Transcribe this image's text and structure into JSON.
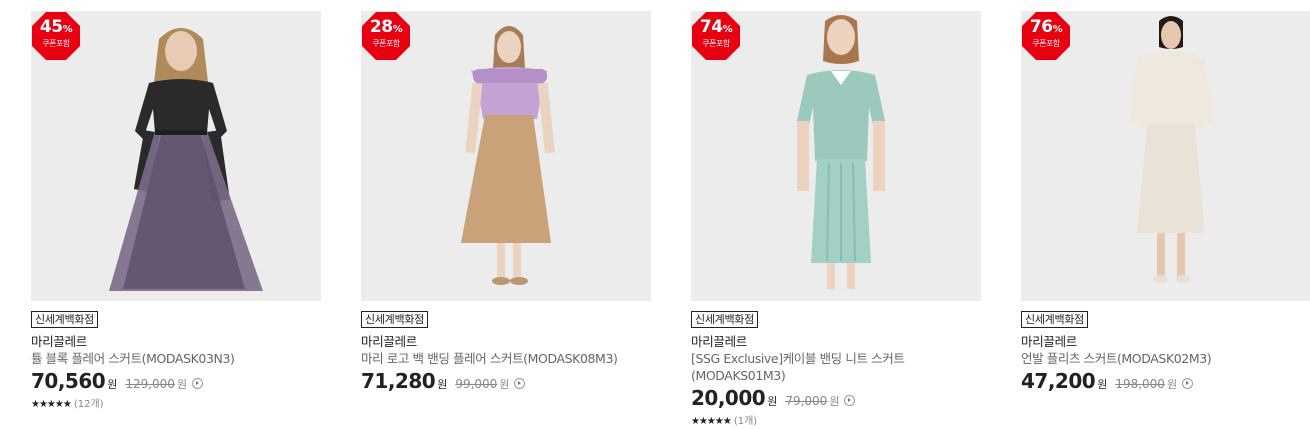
{
  "products": [
    {
      "discount": "45",
      "discount_unit": "%",
      "coupon": "쿠폰포함",
      "store": "신세계백화점",
      "brand": "마리끌레르",
      "name": "튤 블록 플레어 스커트(MODASK03N3)",
      "price": "70,560",
      "price_unit": "원",
      "original_price": "129,000",
      "original_unit": "원",
      "stars": "★★★★★",
      "reviews": "(12개)"
    },
    {
      "discount": "28",
      "discount_unit": "%",
      "coupon": "쿠폰포함",
      "store": "신세계백화점",
      "brand": "마리끌레르",
      "name": "마리 로고 백 밴딩 플레어 스커트(MODASK08M3)",
      "price": "71,280",
      "price_unit": "원",
      "original_price": "99,000",
      "original_unit": "원"
    },
    {
      "discount": "74",
      "discount_unit": "%",
      "coupon": "쿠폰포함",
      "store": "신세계백화점",
      "brand": "마리끌레르",
      "name": "[SSG Exclusive]케이블 밴딩 니트 스커트(MODAKS01M3)",
      "price": "20,000",
      "price_unit": "원",
      "original_price": "79,000",
      "original_unit": "원",
      "stars": "★★★★★",
      "reviews": "(1개)"
    },
    {
      "discount": "76",
      "discount_unit": "%",
      "coupon": "쿠폰포함",
      "store": "신세계백화점",
      "brand": "마리끌레르",
      "name": "언발 플리츠 스커트(MODASK02M3)",
      "price": "47,200",
      "price_unit": "원",
      "original_price": "198,000",
      "original_unit": "원"
    }
  ],
  "colors": {
    "badge_red": "#e60012",
    "photo_bg": "#ececec"
  }
}
